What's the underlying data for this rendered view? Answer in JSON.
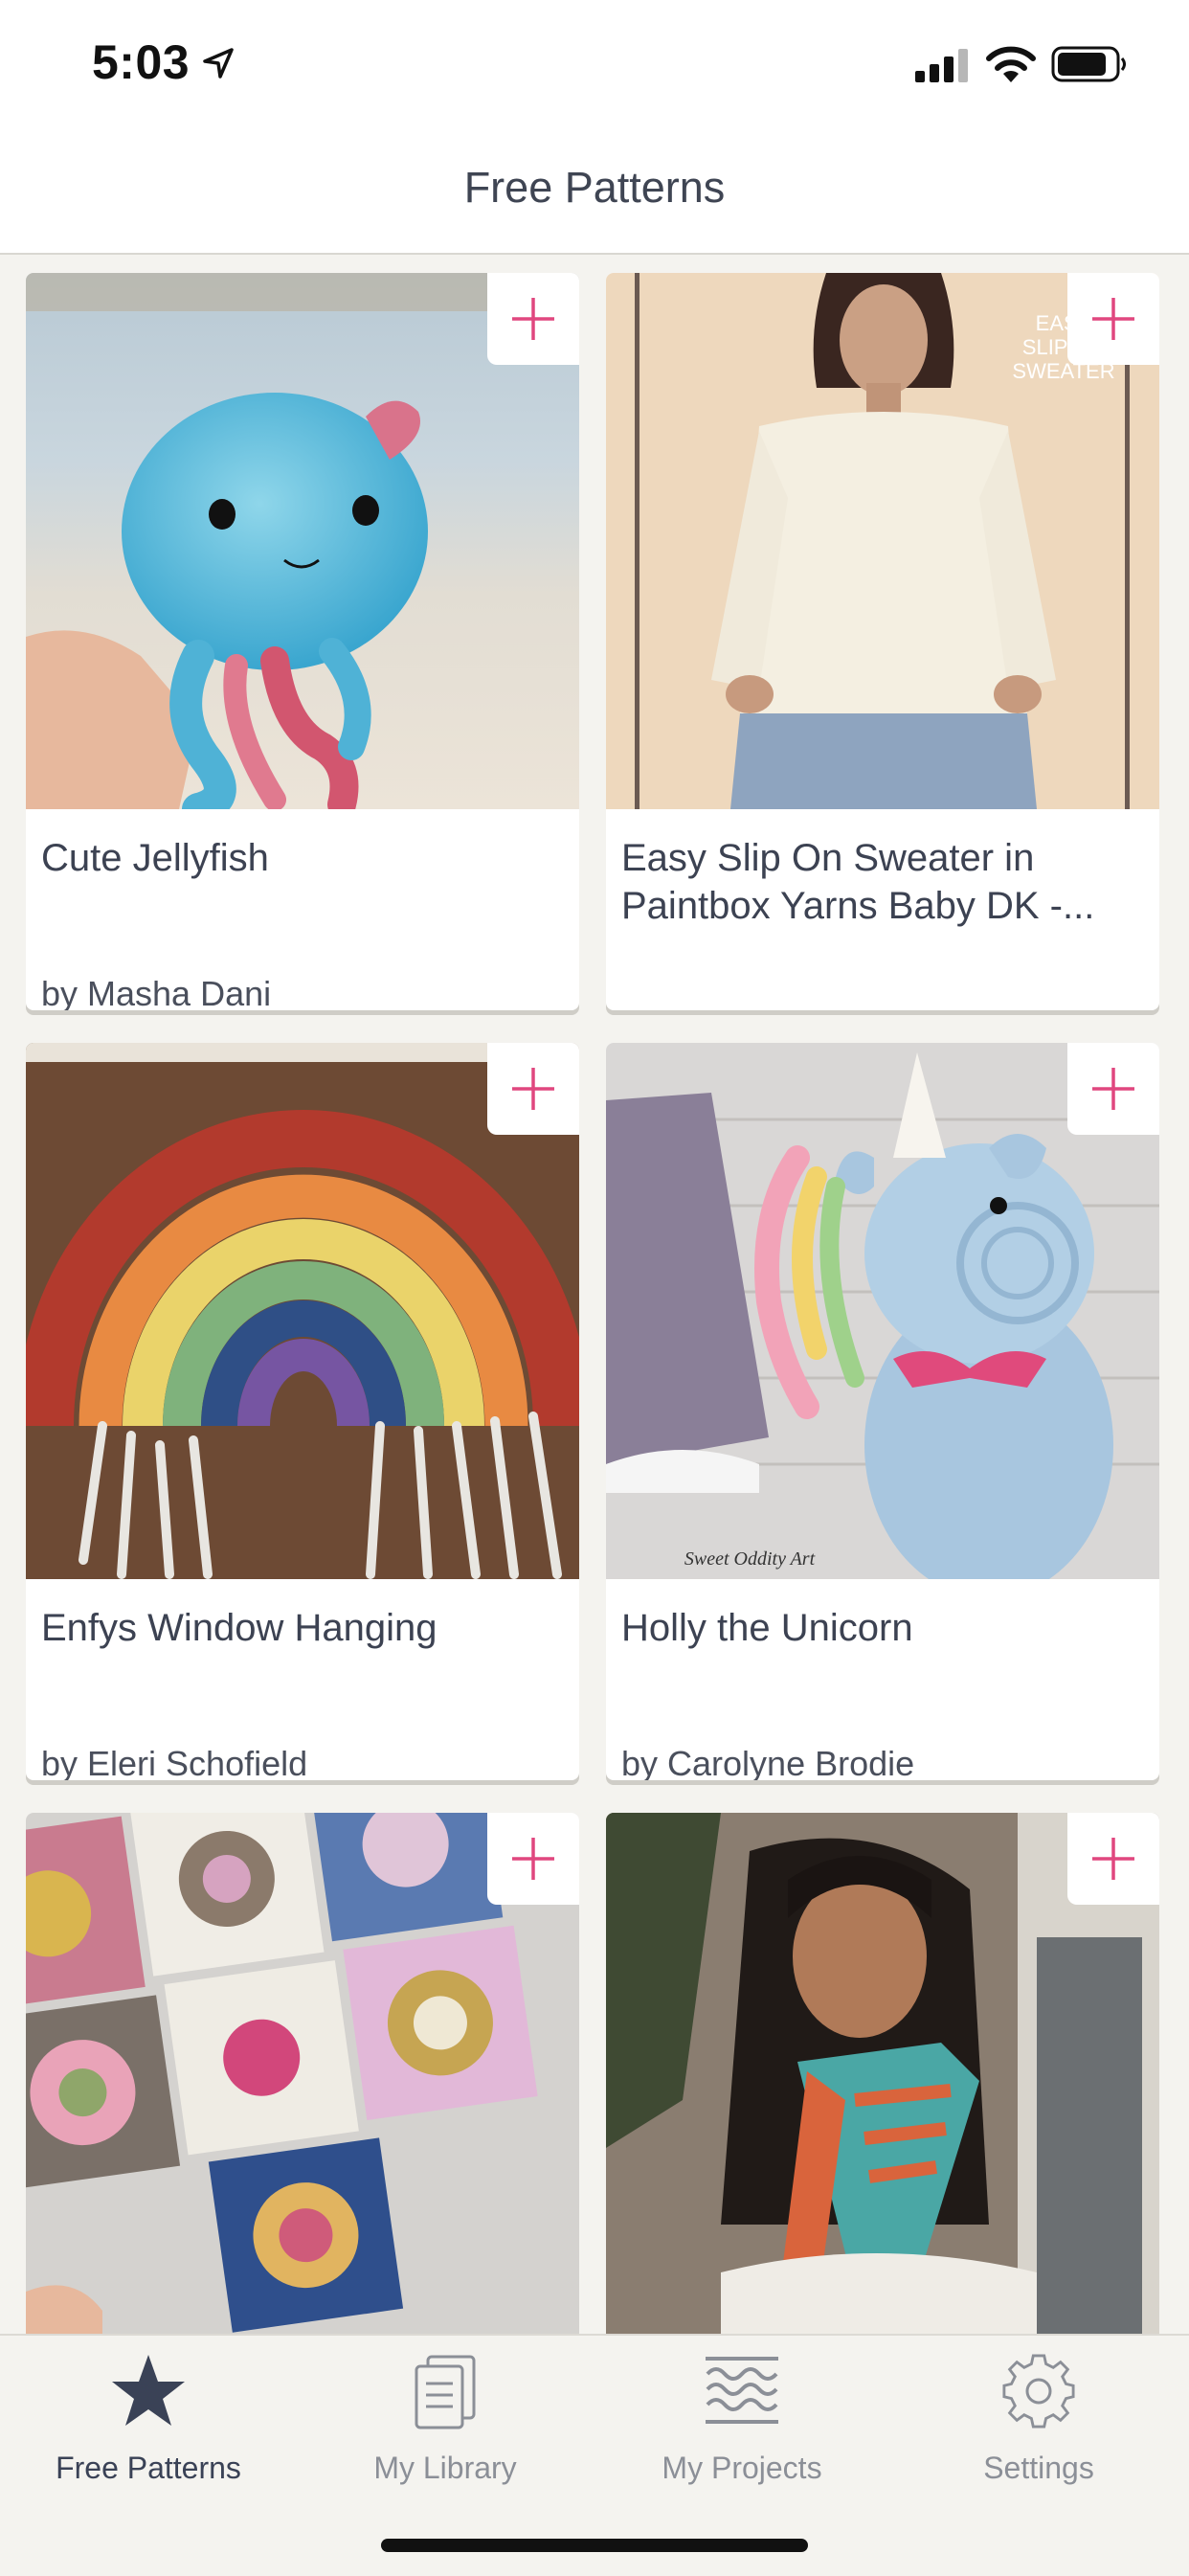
{
  "status_bar": {
    "time": "5:03",
    "icons": [
      "location-arrow-icon",
      "cellular-signal-icon",
      "wifi-icon",
      "battery-icon"
    ]
  },
  "header": {
    "title": "Free Patterns"
  },
  "colors": {
    "accent": "#e0477f",
    "text": "#3b4150",
    "background": "#f4f3ef",
    "tab_active": "#3a4256",
    "tab_inactive": "#8b8f97"
  },
  "patterns": [
    {
      "title": "Cute Jellyfish",
      "author": "by Masha Dani",
      "image": "crochet-jellyfish-photo"
    },
    {
      "title": "Easy Slip On Sweater in Paintbox Yarns Baby DK -...",
      "author": "",
      "image": "knit-sweater-photo",
      "image_overlay_text": "EASY SLIP ON SWEATER"
    },
    {
      "title": "Enfys Window Hanging",
      "author": "by Eleri Schofield",
      "image": "rainbow-hanging-photo"
    },
    {
      "title": "Holly the Unicorn",
      "author": "by Carolyne Brodie",
      "image": "crochet-unicorn-photo",
      "image_overlay_text": "Sweet Oddity Art"
    },
    {
      "title": "",
      "author": "",
      "image": "granny-square-blanket-photo"
    },
    {
      "title": "",
      "author": "",
      "image": "knit-shawl-photo"
    }
  ],
  "tabs": [
    {
      "label": "Free Patterns",
      "icon": "star-icon",
      "active": true
    },
    {
      "label": "My Library",
      "icon": "library-icon",
      "active": false
    },
    {
      "label": "My Projects",
      "icon": "projects-icon",
      "active": false
    },
    {
      "label": "Settings",
      "icon": "gear-icon",
      "active": false
    }
  ]
}
